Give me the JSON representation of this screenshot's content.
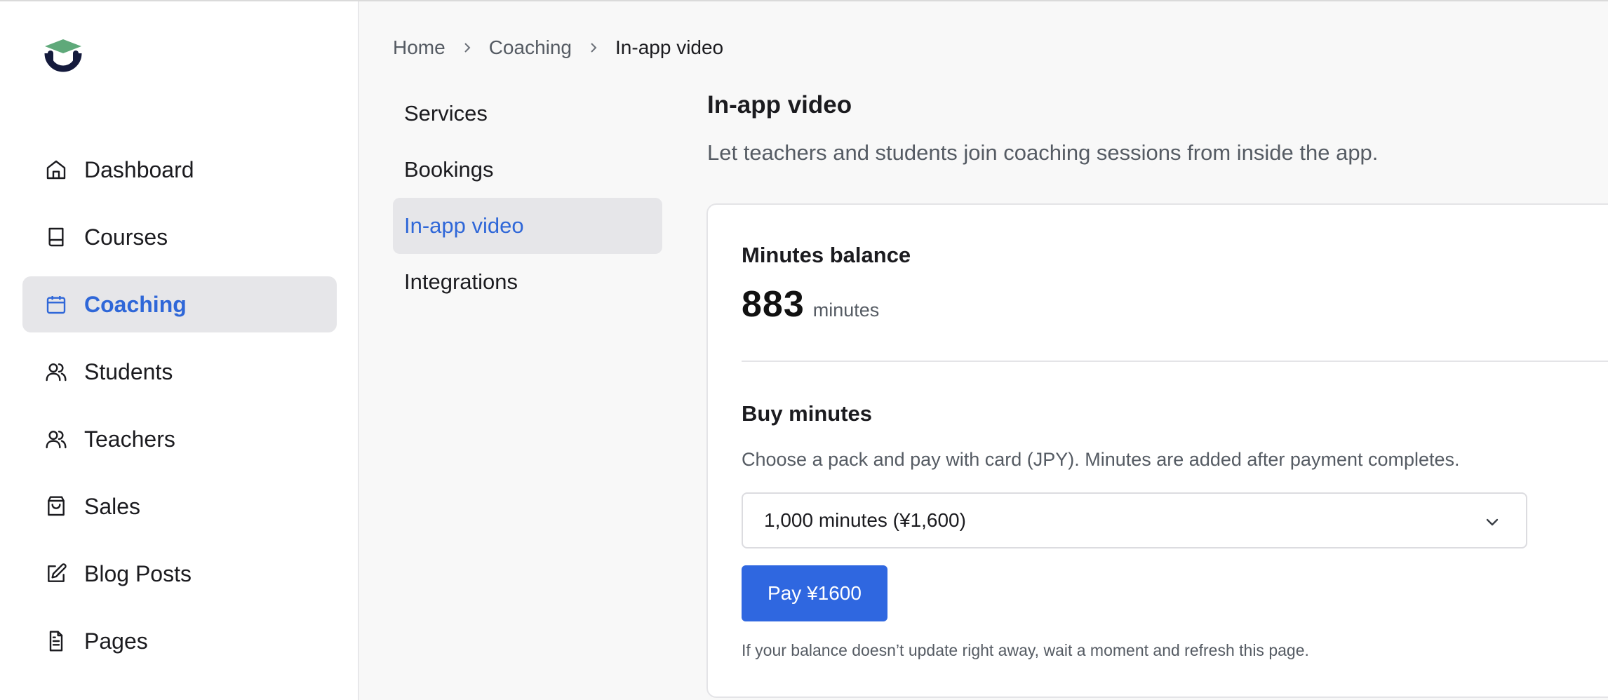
{
  "app": {
    "logo_icon": "graduation-cap-logo",
    "accent_color": "#2f67d8",
    "button_color": "#2f67e0"
  },
  "sidebar": {
    "items": [
      {
        "label": "Dashboard",
        "icon": "home-icon",
        "active": false
      },
      {
        "label": "Courses",
        "icon": "book-icon",
        "active": false
      },
      {
        "label": "Coaching",
        "icon": "calendar-icon",
        "active": true
      },
      {
        "label": "Students",
        "icon": "users-icon",
        "active": false
      },
      {
        "label": "Teachers",
        "icon": "users-icon",
        "active": false
      },
      {
        "label": "Sales",
        "icon": "shopping-bag-icon",
        "active": false
      },
      {
        "label": "Blog Posts",
        "icon": "edit-icon",
        "active": false
      },
      {
        "label": "Pages",
        "icon": "file-text-icon",
        "active": false
      }
    ]
  },
  "breadcrumb": {
    "items": [
      "Home",
      "Coaching",
      "In-app video"
    ]
  },
  "subnav": {
    "items": [
      {
        "label": "Services",
        "active": false
      },
      {
        "label": "Bookings",
        "active": false
      },
      {
        "label": "In-app video",
        "active": true
      },
      {
        "label": "Integrations",
        "active": false
      }
    ]
  },
  "main": {
    "title": "In-app video",
    "description": "Let teachers and students join coaching sessions from inside the app.",
    "balance": {
      "heading": "Minutes balance",
      "value": "883",
      "unit": "minutes"
    },
    "buy": {
      "heading": "Buy minutes",
      "description": "Choose a pack and pay with card (JPY). Minutes are added after payment completes.",
      "selected_pack": "1,000 minutes (¥1,600)",
      "pay_label": "Pay ¥1600",
      "note": "If your balance doesn’t update right away, wait a moment and refresh this page."
    }
  }
}
